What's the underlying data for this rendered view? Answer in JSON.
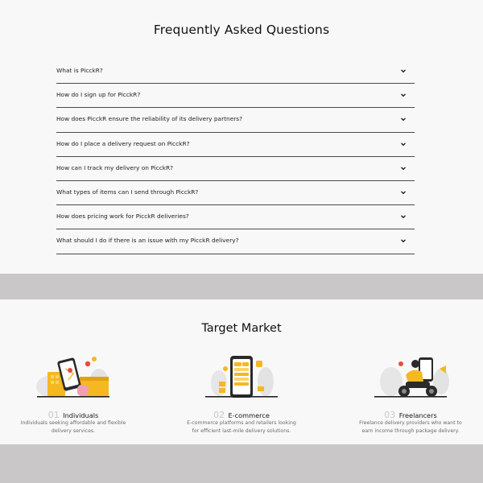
{
  "faq": {
    "title": "Frequently Asked Questions",
    "items": [
      {
        "question": "What is PicckR?"
      },
      {
        "question": "How do I sign up for PicckR?"
      },
      {
        "question": "How does PicckR ensure the reliability of its delivery partners?"
      },
      {
        "question": "How do I place a delivery request on PicckR?"
      },
      {
        "question": "How can I track my delivery on PicckR?"
      },
      {
        "question": "What types of items can I send through PicckR?"
      },
      {
        "question": "How does pricing work for PicckR deliveries?"
      },
      {
        "question": "What should I do if there is an issue with my PicckR delivery?"
      }
    ]
  },
  "target_market": {
    "title": "Target Market",
    "cards": [
      {
        "number": "01",
        "name": "Individuals",
        "description_line1": "Individuals seeking affordable and flexible",
        "description_line2": "delivery services.",
        "icon": "individuals-illustration"
      },
      {
        "number": "02",
        "name": "E-commerce",
        "description_line1": "E-commerce platforms and retailers looking",
        "description_line2": "for efficient last-mile delivery solutions.",
        "icon": "ecommerce-illustration"
      },
      {
        "number": "03",
        "name": "Freelancers",
        "description_line1": "Freelance delivery providers who want to",
        "description_line2": "earn income through package delivery.",
        "icon": "freelancers-illustration"
      }
    ]
  },
  "colors": {
    "accent": "#f5b820",
    "background": "#f8f8f8",
    "band": "#c9c7c8",
    "divider": "#4a4a4a"
  }
}
